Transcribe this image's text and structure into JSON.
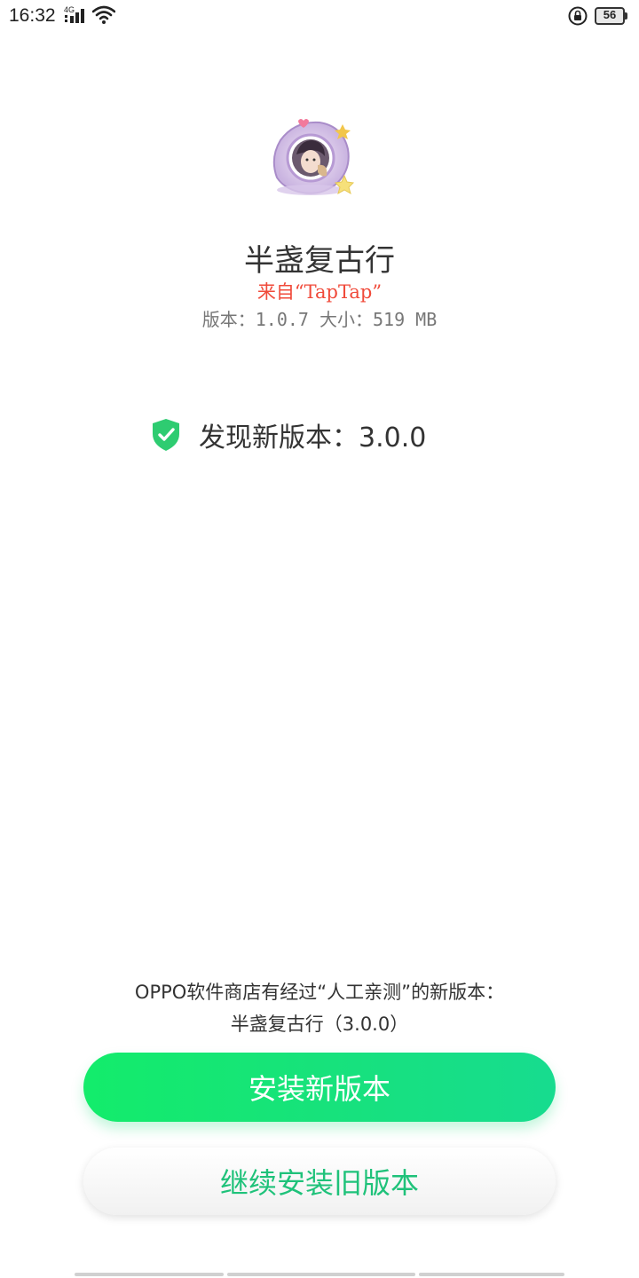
{
  "status_bar": {
    "time": "16:32",
    "network": "4G",
    "battery": "56"
  },
  "app": {
    "icon": "app-avatar-icon",
    "name": "半盏复古行",
    "source": "来自“TapTap”",
    "meta": "版本：1.0.7  大小：519 MB"
  },
  "update": {
    "icon": "shield-check-icon",
    "text": "发现新版本：3.0.0"
  },
  "notice": {
    "line1": "OPPO软件商店有经过“人工亲测”的新版本：",
    "line2": "半盏复古行（3.0.0）"
  },
  "buttons": {
    "install_new": "安装新版本",
    "install_old": "继续安装旧版本"
  },
  "colors": {
    "accent_green": "#17e27b",
    "source_red": "#f04a3a",
    "shield_green": "#2ecc71"
  }
}
